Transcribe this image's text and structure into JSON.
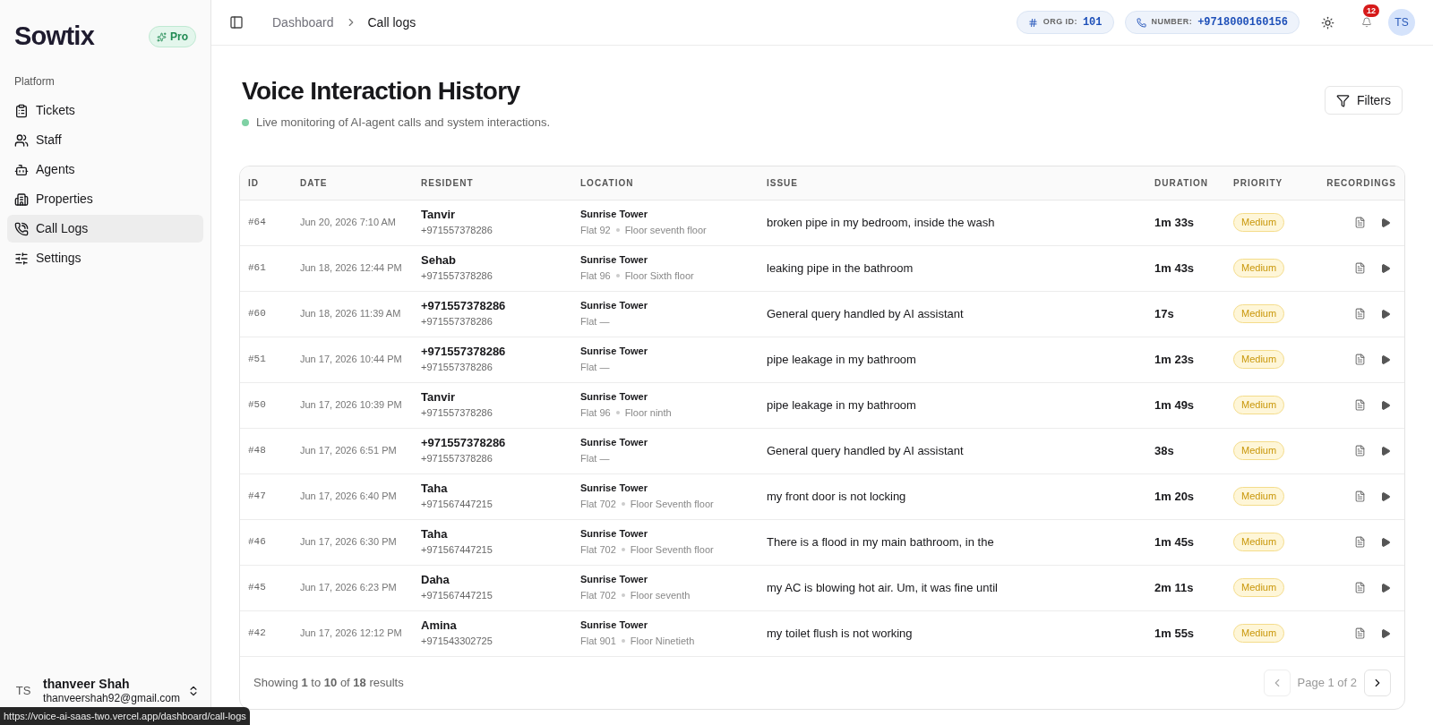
{
  "sidebar": {
    "logo": "Sowtix",
    "plan_badge": "Pro",
    "section_label": "Platform",
    "items": [
      {
        "label": "Tickets",
        "selected": false
      },
      {
        "label": "Staff",
        "selected": false
      },
      {
        "label": "Agents",
        "selected": false
      },
      {
        "label": "Properties",
        "selected": false
      },
      {
        "label": "Call Logs",
        "selected": true
      },
      {
        "label": "Settings",
        "selected": false
      }
    ],
    "user": {
      "initials": "TS",
      "name": "thanveer Shah",
      "email": "thanveershah92@gmail.com"
    }
  },
  "topbar": {
    "breadcrumbs": [
      {
        "label": "Dashboard",
        "selected": false
      },
      {
        "label": "Call logs",
        "selected": true
      }
    ],
    "org_id": {
      "label": "ORG ID:",
      "value": "101"
    },
    "number": {
      "label": "NUMBER:",
      "value": "+9718000160156"
    },
    "notification_count": "12",
    "avatar": "TS"
  },
  "page": {
    "title": "Voice Interaction History",
    "subtitle": "Live monitoring of AI-agent calls and system interactions.",
    "filters_button": "Filters"
  },
  "table": {
    "columns": [
      "ID",
      "DATE",
      "RESIDENT",
      "LOCATION",
      "ISSUE",
      "DURATION",
      "PRIORITY",
      "RECORDINGS"
    ],
    "rows": [
      {
        "id": "#64",
        "date": "Jun 20, 2026 7:10 AM",
        "resident": "Tanvir",
        "phone": "+971557378286",
        "building": "Sunrise Tower",
        "flat": "Flat 92",
        "floor": "Floor seventh floor",
        "issue": "broken pipe in my bedroom, inside the wash",
        "duration": "1m 33s",
        "priority": "Medium"
      },
      {
        "id": "#61",
        "date": "Jun 18, 2026 12:44 PM",
        "resident": "Sehab",
        "phone": "+971557378286",
        "building": "Sunrise Tower",
        "flat": "Flat 96",
        "floor": "Floor Sixth floor",
        "issue": "leaking pipe in the bathroom",
        "duration": "1m 43s",
        "priority": "Medium"
      },
      {
        "id": "#60",
        "date": "Jun 18, 2026 11:39 AM",
        "resident": "+971557378286",
        "phone": "+971557378286",
        "building": "Sunrise Tower",
        "flat": "Flat —",
        "issue": "General query handled by AI assistant",
        "duration": "17s",
        "priority": "Medium"
      },
      {
        "id": "#51",
        "date": "Jun 17, 2026 10:44 PM",
        "resident": "+971557378286",
        "phone": "+971557378286",
        "building": "Sunrise Tower",
        "flat": "Flat —",
        "issue": "pipe leakage in my bathroom",
        "duration": "1m 23s",
        "priority": "Medium"
      },
      {
        "id": "#50",
        "date": "Jun 17, 2026 10:39 PM",
        "resident": "Tanvir",
        "phone": "+971557378286",
        "building": "Sunrise Tower",
        "flat": "Flat 96",
        "floor": "Floor ninth",
        "issue": "pipe leakage in my bathroom",
        "duration": "1m 49s",
        "priority": "Medium"
      },
      {
        "id": "#48",
        "date": "Jun 17, 2026 6:51 PM",
        "resident": "+971557378286",
        "phone": "+971557378286",
        "building": "Sunrise Tower",
        "flat": "Flat —",
        "issue": "General query handled by AI assistant",
        "duration": "38s",
        "priority": "Medium"
      },
      {
        "id": "#47",
        "date": "Jun 17, 2026 6:40 PM",
        "resident": "Taha",
        "phone": "+971567447215",
        "building": "Sunrise Tower",
        "flat": "Flat 702",
        "floor": "Floor Seventh floor",
        "issue": "my front door is not locking",
        "duration": "1m 20s",
        "priority": "Medium"
      },
      {
        "id": "#46",
        "date": "Jun 17, 2026 6:30 PM",
        "resident": "Taha",
        "phone": "+971567447215",
        "building": "Sunrise Tower",
        "flat": "Flat 702",
        "floor": "Floor Seventh floor",
        "issue": "There is a flood in my main bathroom, in the",
        "duration": "1m 45s",
        "priority": "Medium"
      },
      {
        "id": "#45",
        "date": "Jun 17, 2026 6:23 PM",
        "resident": "Daha",
        "phone": "+971567447215",
        "building": "Sunrise Tower",
        "flat": "Flat 702",
        "floor": "Floor seventh",
        "issue": "my AC is blowing hot air. Um, it was fine until",
        "duration": "2m 11s",
        "priority": "Medium"
      },
      {
        "id": "#42",
        "date": "Jun 17, 2026 12:12 PM",
        "resident": "Amina",
        "phone": "+971543302725",
        "building": "Sunrise Tower",
        "flat": "Flat 901",
        "floor": "Floor Ninetieth",
        "issue": "my toilet flush is not working",
        "duration": "1m 55s",
        "priority": "Medium"
      }
    ],
    "footer": "Showing **1** to **10** of **18** results",
    "page_label": "Page 1 of 2"
  },
  "status_url": "https://voice-ai-saas-two.vercel.app/dashboard/call-logs"
}
